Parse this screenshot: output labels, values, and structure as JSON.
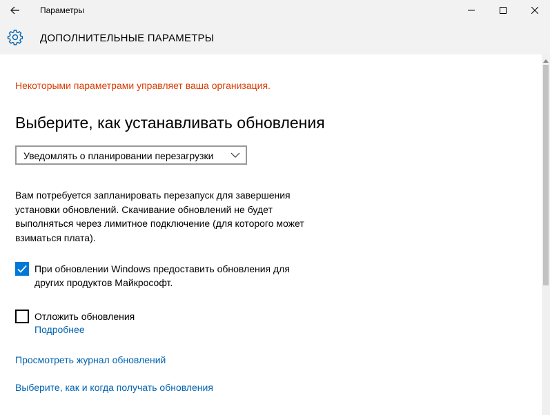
{
  "window": {
    "title": "Параметры"
  },
  "header": {
    "title": "ДОПОЛНИТЕЛЬНЫЕ ПАРАМЕТРЫ",
    "icon": "gear-icon"
  },
  "main": {
    "org_note": "Некоторыми параметрами управляет ваша организация.",
    "section_title": "Выберите, как устанавливать обновления",
    "install_mode": {
      "selected": "Уведомлять о планировании перезагрузки"
    },
    "description": "Вам потребуется запланировать перезапуск для завершения установки обновлений. Скачивание обновлений не будет выполняться через лимитное подключение (для которого может взиматься плата).",
    "checkbox_other_products": {
      "checked": true,
      "label_line1": "При обновлении Windows предоставить обновления для",
      "label_line2": "других продуктов Майкрософт."
    },
    "checkbox_defer": {
      "checked": false,
      "label": "Отложить обновления",
      "more_link": "Подробнее"
    },
    "links": {
      "history": "Просмотреть журнал обновлений",
      "delivery": "Выберите, как и когда получать обновления"
    }
  },
  "colors": {
    "warning": "#d83b01",
    "accent": "#0078d7",
    "link": "#0063b1",
    "chrome": "#f2f2f2"
  }
}
